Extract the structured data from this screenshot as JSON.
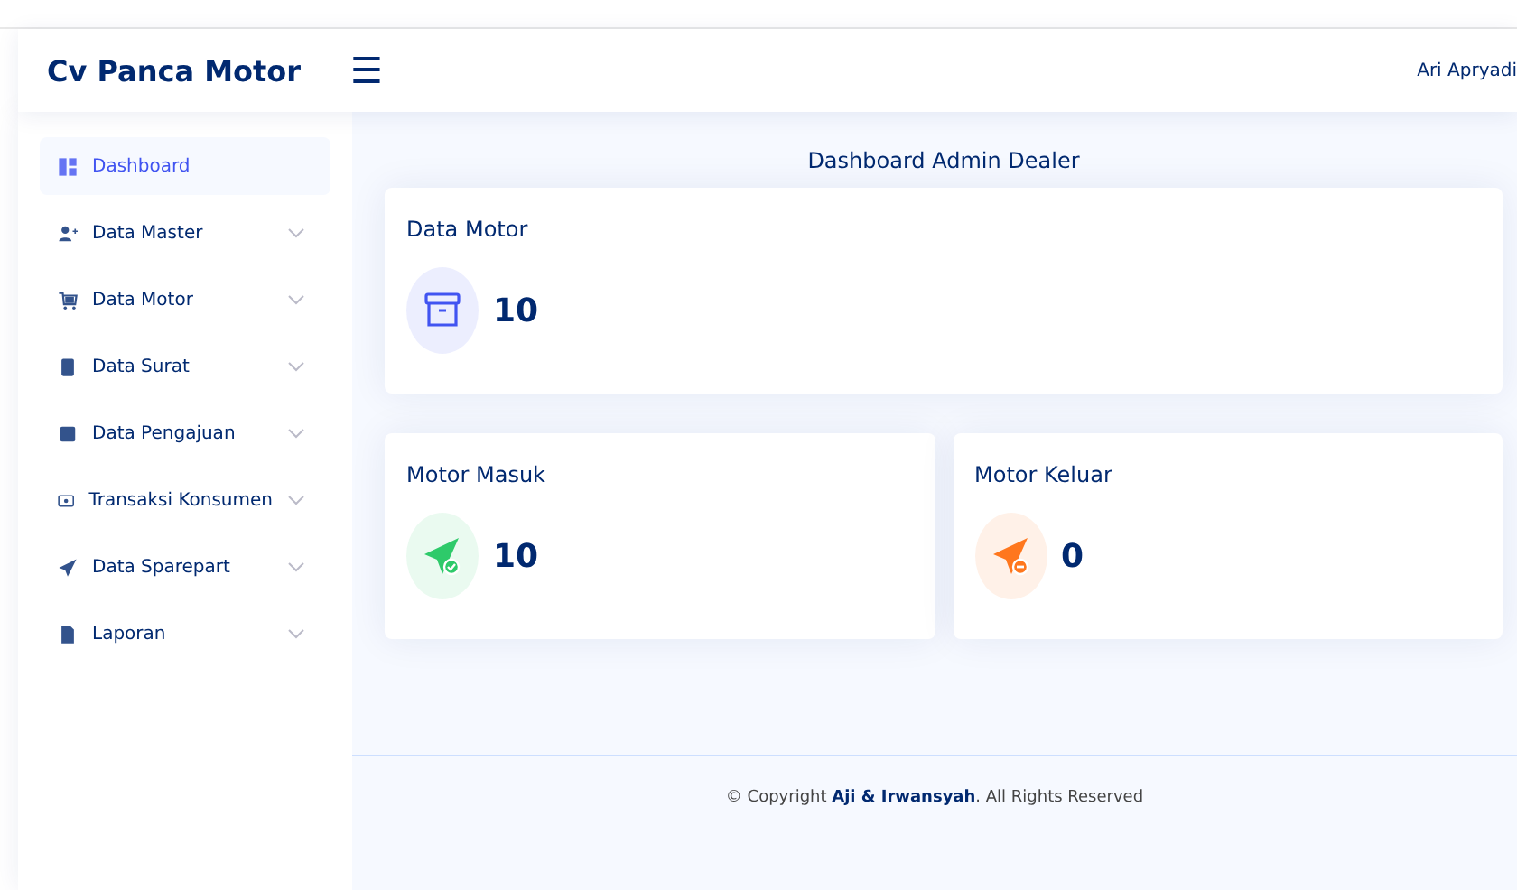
{
  "header": {
    "brand": "Cv Panca Motor",
    "menu_icon": "☰",
    "user": "Ari Apryadi"
  },
  "sidebar": {
    "items": [
      {
        "label": "Dashboard",
        "kind": "link",
        "selected": true
      },
      {
        "label": "Data Master",
        "kind": "dropdown",
        "selected": false
      },
      {
        "label": "Data Motor",
        "kind": "dropdown",
        "selected": false
      },
      {
        "label": "Data Surat",
        "kind": "dropdown",
        "selected": false
      },
      {
        "label": "Data Pengajuan",
        "kind": "dropdown",
        "selected": false
      },
      {
        "label": "Transaksi Konsumen",
        "kind": "dropdown",
        "selected": false
      },
      {
        "label": "Data Sparepart",
        "kind": "dropdown",
        "selected": false
      },
      {
        "label": "Laporan",
        "kind": "dropdown",
        "selected": false
      }
    ]
  },
  "page_title": "Dashboard Admin Dealer",
  "cards": [
    {
      "title": "Data Motor",
      "value": "10",
      "color": "#4154f1"
    },
    {
      "title": "Motor Masuk",
      "value": "10",
      "color": "#2eca6a"
    },
    {
      "title": "Motor Keluar",
      "value": "0",
      "color": "#ff771d"
    }
  ],
  "footer": "© Copyright **Aji & Irwansyah**. All Rights Reserved"
}
